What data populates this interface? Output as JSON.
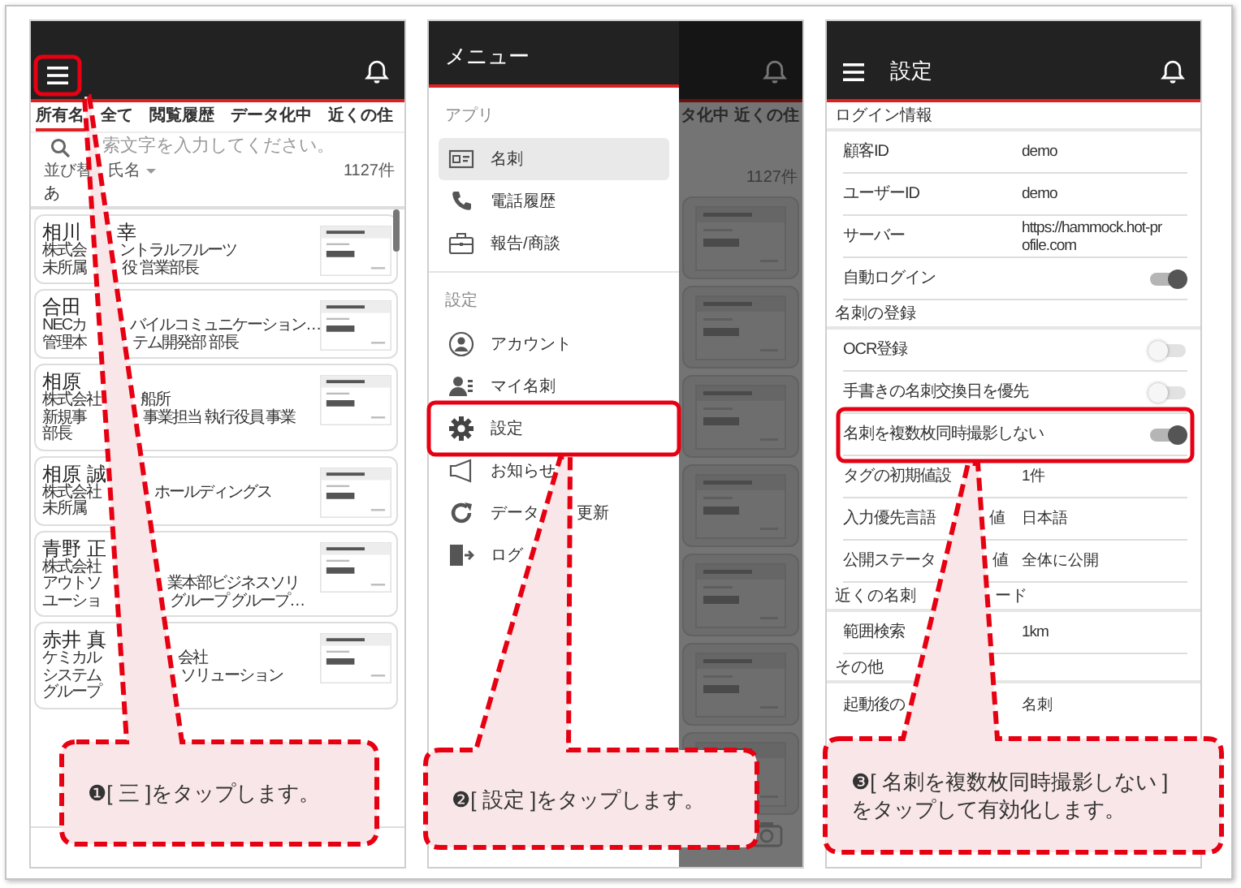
{
  "panels": [
    {
      "kind": "card-list",
      "tabs": [
        {
          "label": "所有名",
          "selected": true
        },
        {
          "label": "全て",
          "selected": false
        },
        {
          "label": "閲覧履歴",
          "selected": false
        },
        {
          "label": "データ化中",
          "selected": false
        },
        {
          "label": "近くの住",
          "selected": false
        }
      ],
      "search": {
        "placeholder": "索文字を入力してください。"
      },
      "sort": {
        "label": "並び替",
        "value": "氏名"
      },
      "count": "1127件",
      "index": "あ",
      "cards": [
        {
          "name": [
            "相川",
            "幸"
          ],
          "lines": [
            [
              "株式会",
              "ントラルフルーツ"
            ],
            [
              "未所属",
              "役 営業部長"
            ]
          ]
        },
        {
          "name": [
            "合田"
          ],
          "lines": [
            [
              "NECカ",
              "バイルコミュニケーション…"
            ],
            [
              "管理本",
              "テム開発部 部長"
            ]
          ]
        },
        {
          "name": [
            "相原"
          ],
          "lines": [
            [
              "株式会社",
              "船所"
            ],
            [
              "新規事",
              "事業担当 執行役員 事業"
            ],
            [
              "部長"
            ]
          ]
        },
        {
          "name": [
            "相原 誠"
          ],
          "lines": [
            [
              "株式会社",
              "ホールディングス"
            ],
            [
              "未所属"
            ]
          ]
        },
        {
          "name": [
            "青野 正"
          ],
          "lines": [
            [
              "株式会社"
            ],
            [
              "アウトソ",
              "業本部ビジネスソリ"
            ],
            [
              "ユーショ",
              "グループ グループ…"
            ]
          ]
        },
        {
          "name": [
            "赤井 真"
          ],
          "lines": [
            [
              "ケミカル",
              "会社"
            ],
            [
              "システム",
              "ソリューション"
            ],
            [
              "グループ"
            ]
          ]
        }
      ]
    },
    {
      "kind": "menu",
      "title": "メニュー",
      "sections": [
        {
          "label": "アプリ",
          "items": [
            {
              "label": [
                "名刺"
              ],
              "selected": true
            },
            {
              "label": [
                "電話履歴"
              ],
              "selected": false
            },
            {
              "label": [
                "報告/商談"
              ],
              "selected": false
            }
          ]
        },
        {
          "label": "設定",
          "items": [
            {
              "label": [
                "アカウント"
              ],
              "selected": false
            },
            {
              "label": [
                "マイ名刺"
              ],
              "selected": false
            },
            {
              "label": [
                "設定"
              ],
              "selected": false
            },
            {
              "label": [
                "お知らせ"
              ],
              "selected": false
            },
            {
              "label": [
                "データ",
                "更新"
              ],
              "selected": false
            },
            {
              "label": [
                "ログ"
              ],
              "selected": false
            }
          ]
        }
      ],
      "behind": {
        "tabs": [
          "タ化中",
          "近くの住"
        ],
        "count": "1127件"
      }
    },
    {
      "kind": "settings",
      "title": "設定",
      "sections": [
        {
          "label": [
            "ログイン情報"
          ],
          "rows": [
            {
              "kind": "value",
              "label": [
                "顧客ID"
              ],
              "value": "demo"
            },
            {
              "kind": "value",
              "label": [
                "ユーザーID"
              ],
              "value": "demo"
            },
            {
              "kind": "value",
              "label": [
                "サーバー"
              ],
              "value": "https://hammock.hot-profile.com"
            },
            {
              "kind": "toggle",
              "label": [
                "自動ログイン"
              ],
              "on": true
            }
          ]
        },
        {
          "label": [
            "名刺の登録"
          ],
          "rows": [
            {
              "kind": "toggle",
              "label": [
                "OCR登録"
              ],
              "on": false
            },
            {
              "kind": "toggle",
              "label": [
                "手書きの名刺交換日を優先"
              ],
              "on": false
            },
            {
              "kind": "toggle",
              "label": [
                "名刺を複数枚同時撮影しない"
              ],
              "on": true
            },
            {
              "kind": "value",
              "label": [
                "タグの初期値設"
              ],
              "value": "1件"
            },
            {
              "kind": "value",
              "label": [
                "入力優先言語",
                "値"
              ],
              "value": "日本語"
            },
            {
              "kind": "value",
              "label": [
                "公開ステータ",
                "値"
              ],
              "value": "全体に公開"
            }
          ]
        },
        {
          "label": [
            "近くの名刺",
            "ード"
          ],
          "rows": [
            {
              "kind": "value",
              "label": [
                "範囲検索"
              ],
              "value": "1km"
            }
          ]
        },
        {
          "label": [
            "その他"
          ],
          "rows": [
            {
              "kind": "value",
              "label": [
                "起動後の"
              ],
              "value": "名刺"
            }
          ]
        }
      ]
    }
  ],
  "callouts": [
    {
      "lines": [
        "❶[ 三 ]をタップします。"
      ]
    },
    {
      "lines": [
        "❷[ 設定 ]をタップします。"
      ]
    },
    {
      "lines": [
        "❸[ 名刺を複数枚同時撮影しない ]",
        "をタップして有効化します。"
      ]
    }
  ]
}
